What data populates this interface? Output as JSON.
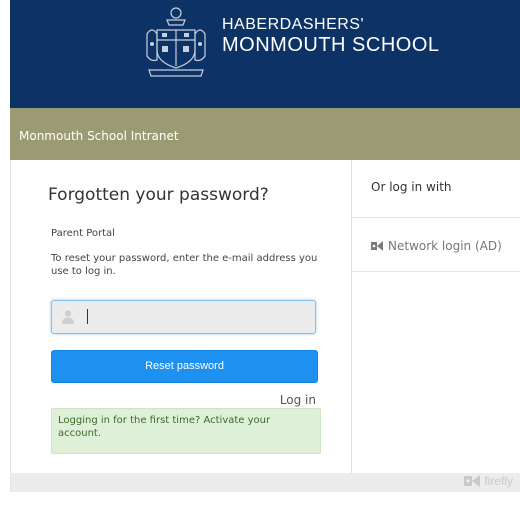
{
  "header": {
    "school_name_line1": "HABERDASHERS'",
    "school_name_line2": "MONMOUTH SCHOOL",
    "crest_icon": "school-crest-icon",
    "background_color": "#0d3366"
  },
  "bar": {
    "title": "Monmouth School Intranet",
    "background_color": "#9b9b73"
  },
  "form": {
    "heading": "Forgotten your password?",
    "portal_label": "Parent Portal",
    "instructions": "To reset your password, enter the e-mail address you use to log in.",
    "email_value": "",
    "user_icon": "user-icon",
    "reset_button_label": "Reset password",
    "login_link_label": "Log in",
    "activate_message": "Logging in for the first time? Activate your account.",
    "accent_color": "#1e90f0"
  },
  "sidebar": {
    "or_title": "Or log in with",
    "network_login_label": "Network login (AD)",
    "network_icon": "firefly-icon"
  },
  "footer": {
    "brand_label": "firefly",
    "brand_icon": "firefly-logo-icon"
  }
}
